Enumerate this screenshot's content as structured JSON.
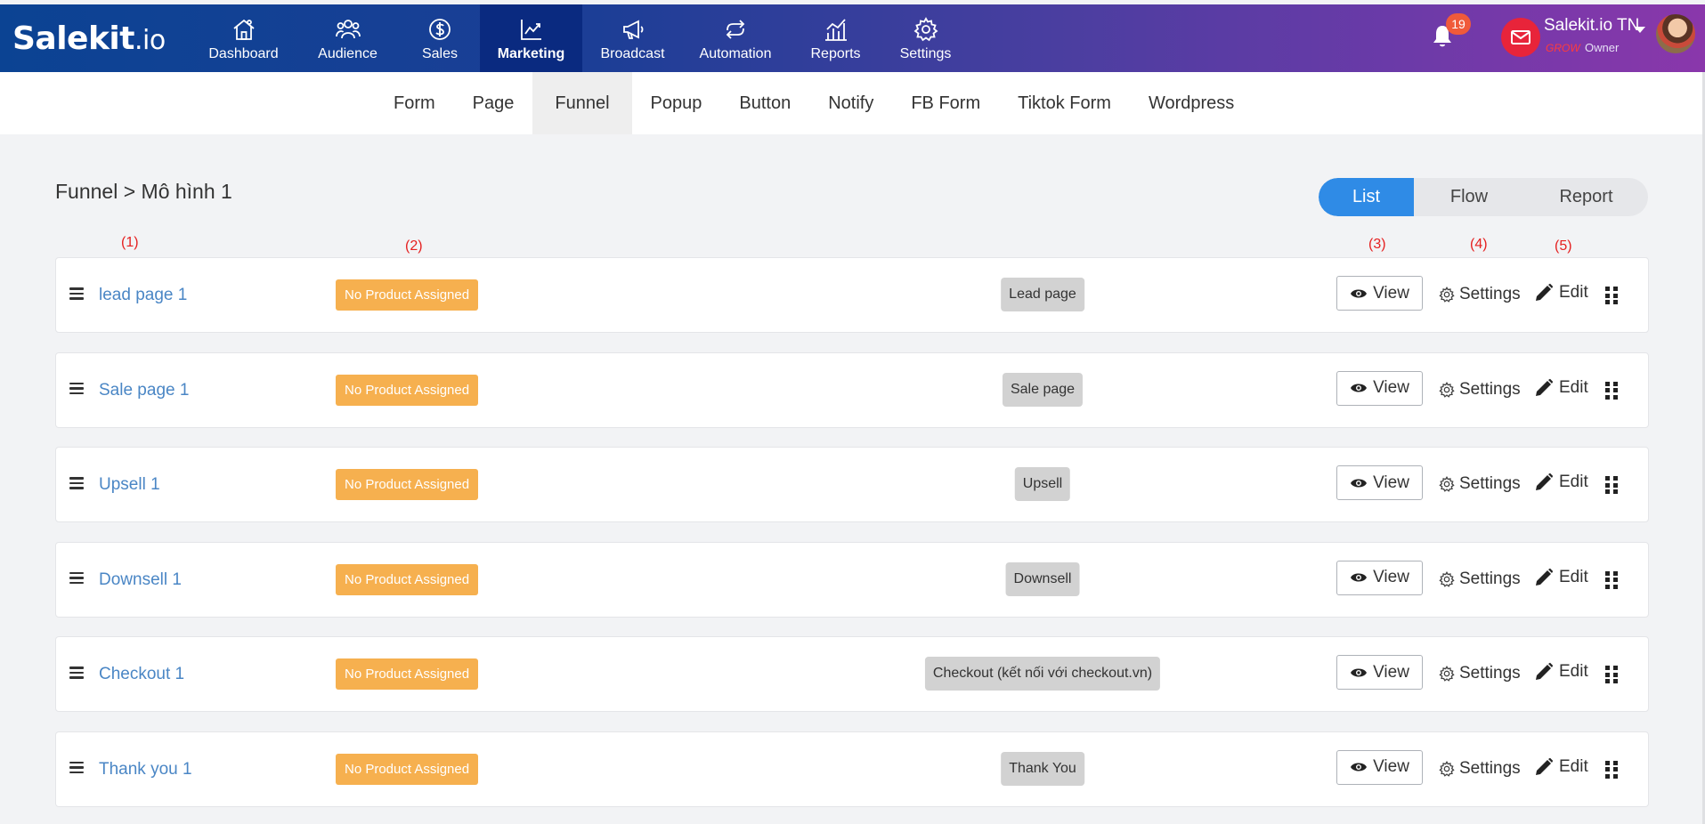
{
  "app": {
    "logo_main": "Salekit",
    "logo_suffix": ".io"
  },
  "topnav": {
    "items": [
      {
        "label": "Dashboard",
        "icon": "house-icon",
        "active": false
      },
      {
        "label": "Audience",
        "icon": "users-icon",
        "active": false
      },
      {
        "label": "Sales",
        "icon": "dollar-icon",
        "active": false
      },
      {
        "label": "Marketing",
        "icon": "trend-chart-icon",
        "active": true
      },
      {
        "label": "Broadcast",
        "icon": "megaphone-icon",
        "active": false
      },
      {
        "label": "Automation",
        "icon": "repeat-icon",
        "active": false
      },
      {
        "label": "Reports",
        "icon": "bar-chart-icon",
        "active": false
      },
      {
        "label": "Settings",
        "icon": "gear-icon",
        "active": false
      }
    ],
    "notification_count": "19",
    "user_name": "Salekit.io TN",
    "user_plan": "GROW",
    "user_role": "Owner"
  },
  "subnav": {
    "items": [
      {
        "label": "Form",
        "active": false
      },
      {
        "label": "Page",
        "active": false
      },
      {
        "label": "Funnel",
        "active": true
      },
      {
        "label": "Popup",
        "active": false
      },
      {
        "label": "Button",
        "active": false
      },
      {
        "label": "Notify",
        "active": false
      },
      {
        "label": "FB Form",
        "active": false
      },
      {
        "label": "Tiktok Form",
        "active": false
      },
      {
        "label": "Wordpress",
        "active": false
      }
    ]
  },
  "breadcrumb": "Funnel > Mô hình 1",
  "view_toggle": {
    "options": [
      "List",
      "Flow",
      "Report"
    ],
    "selected": "List"
  },
  "markers": [
    "(1)",
    "(2)",
    "(3)",
    "(4)",
    "(5)"
  ],
  "row_actions": {
    "view": "View",
    "settings": "Settings",
    "edit": "Edit"
  },
  "rows": [
    {
      "name": "lead page 1",
      "product": "No Product Assigned",
      "type": "Lead page"
    },
    {
      "name": "Sale page 1",
      "product": "No Product Assigned",
      "type": "Sale page"
    },
    {
      "name": "Upsell 1",
      "product": "No Product Assigned",
      "type": "Upsell"
    },
    {
      "name": "Downsell 1",
      "product": "No Product Assigned",
      "type": "Downsell"
    },
    {
      "name": "Checkout 1",
      "product": "No Product Assigned",
      "type": "Checkout (kết nối với checkout.vn)"
    },
    {
      "name": "Thank you 1",
      "product": "No Product Assigned",
      "type": "Thank You"
    }
  ],
  "colors": {
    "accent": "#2f8be6",
    "nav_active": "#0a2a80",
    "product_badge": "#f6b04f",
    "link": "#4a86c5",
    "marker": "#e52020"
  }
}
